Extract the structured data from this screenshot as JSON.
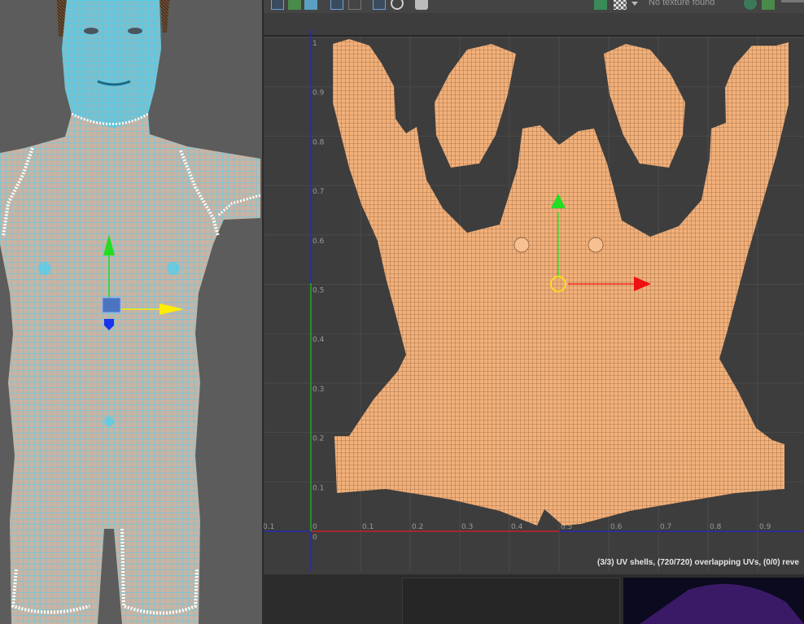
{
  "toolbar": {
    "texture_label": "No texture found",
    "icons": [
      "uv-select-icon",
      "grid-snap-icon",
      "shaded-icon",
      "filter-icon",
      "display-mode-icon",
      "wireframe-icon",
      "checker-icon",
      "camera-icon",
      "image-icon",
      "checkerboard-icon",
      "dropdown-arrow-icon",
      "color-channels-icon",
      "image-view-icon"
    ]
  },
  "uv_grid": {
    "x_ticks": [
      "0.1",
      "0",
      "0.1",
      "0.2",
      "0.3",
      "0.4",
      "0.5",
      "0.6",
      "0.7",
      "0.8",
      "0.9"
    ],
    "y_ticks": [
      "1",
      "0.9",
      "0.8",
      "0.7",
      "0.6",
      "0.5",
      "0.4",
      "0.3",
      "0.2",
      "0.1",
      "0"
    ]
  },
  "status_bar": {
    "text": "(3/3) UV shells, (720/720) overlapping UVs, (0/0) reve"
  },
  "colors": {
    "viewport_bg": "#5c5c5c",
    "uv_bg": "#3d3d3d",
    "wireframe_cyan": "#33d6ff",
    "uv_mesh_orange": "#f2b07a",
    "manip_green": "#22dd22",
    "manip_red": "#ee1111",
    "manip_yellow": "#ffee00",
    "manip_blue": "#2233ff"
  }
}
